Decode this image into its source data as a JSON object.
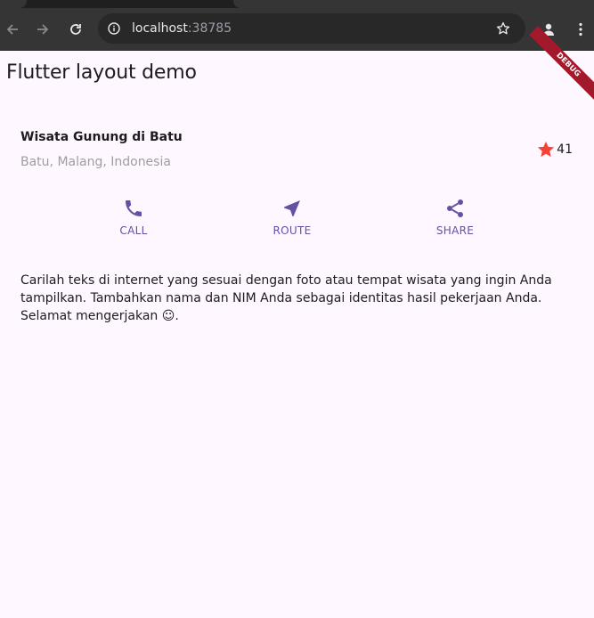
{
  "browser": {
    "url_host": "localhost",
    "url_port": ":38785"
  },
  "app": {
    "title": "Flutter layout demo",
    "debug_banner": "DEBUG"
  },
  "location": {
    "name": "Wisata Gunung di Batu",
    "subtitle": "Batu, Malang, Indonesia",
    "rating_count": "41"
  },
  "actions": [
    {
      "label": "CALL",
      "icon": "phone-icon"
    },
    {
      "label": "ROUTE",
      "icon": "navigation-icon"
    },
    {
      "label": "SHARE",
      "icon": "share-icon"
    }
  ],
  "description": "Carilah teks di internet yang sesuai dengan foto atau tempat wisata yang ingin Anda tampilkan. Tambahkan nama dan NIM Anda sebagai identitas hasil pekerjaan Anda. Selamat mengerjakan ☺.",
  "colors": {
    "accent": "#6750a4",
    "star": "#f44336",
    "background": "#fef7ff"
  }
}
